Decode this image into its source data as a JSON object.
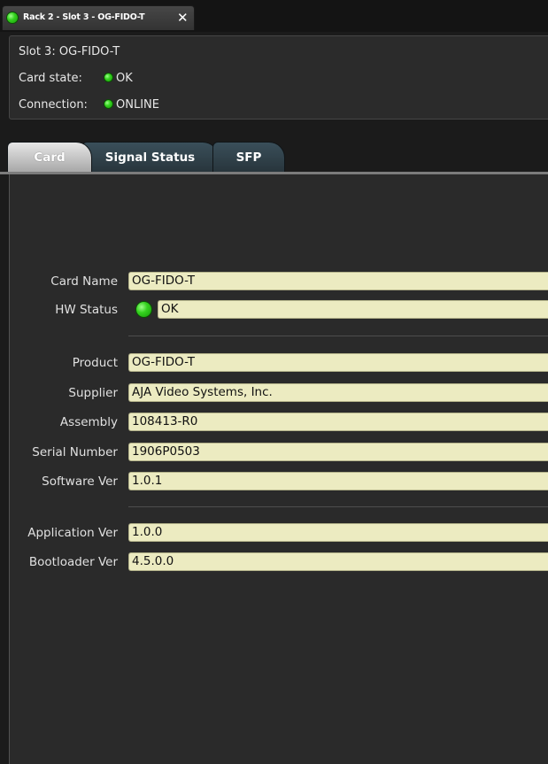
{
  "window_tab": {
    "title": "Rack 2 - Slot 3 - OG-FIDO-T",
    "close_glyph": "✕",
    "status_color": "#35d21f"
  },
  "info": {
    "slot": "Slot 3: OG-FIDO-T",
    "card_state_label": "Card state:",
    "card_state_value": "OK",
    "connection_label": "Connection:",
    "connection_value": "ONLINE"
  },
  "tabs": [
    {
      "label": "Card",
      "active": true
    },
    {
      "label": "Signal Status",
      "active": false
    },
    {
      "label": "SFP",
      "active": false
    }
  ],
  "fields": {
    "card_name": {
      "label": "Card Name",
      "value": "OG-FIDO-T"
    },
    "hw_status": {
      "label": "HW Status",
      "value": "OK"
    },
    "product": {
      "label": "Product",
      "value": "OG-FIDO-T"
    },
    "supplier": {
      "label": "Supplier",
      "value": "AJA Video Systems, Inc."
    },
    "assembly": {
      "label": "Assembly",
      "value": "108413-R0"
    },
    "serial": {
      "label": "Serial Number",
      "value": "1906P0503"
    },
    "software": {
      "label": "Software Ver",
      "value": "1.0.1"
    },
    "application": {
      "label": "Application Ver",
      "value": "1.0.0"
    },
    "bootloader": {
      "label": "Bootloader Ver",
      "value": "4.5.0.0"
    }
  }
}
